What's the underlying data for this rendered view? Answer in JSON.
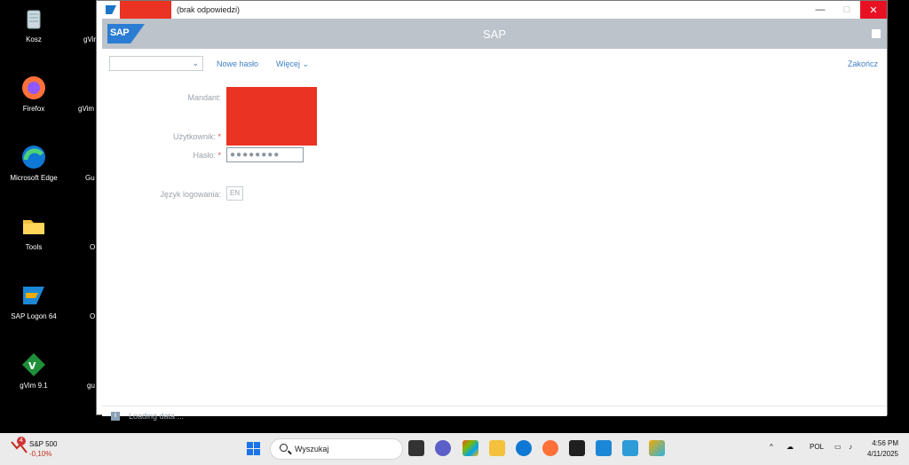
{
  "desktop": {
    "icons": [
      {
        "label": "Kosz",
        "icon": "recycle-bin-icon"
      },
      {
        "label": "Firefox",
        "icon": "firefox-icon"
      },
      {
        "label": "Microsoft Edge",
        "icon": "edge-icon"
      },
      {
        "label": "Tools",
        "icon": "folder-icon"
      },
      {
        "label": "SAP Logon 64",
        "icon": "sap-logon-icon"
      },
      {
        "label": "gVim 9.1",
        "icon": "gvim-icon"
      }
    ],
    "partial_labels": [
      "gVim",
      "gVim R",
      "Gu",
      "O",
      "O",
      "gu"
    ]
  },
  "window": {
    "title": "(brak odpowiedzi)",
    "min_glyph": "—",
    "max_glyph": "□",
    "close_glyph": "✕"
  },
  "shell": {
    "logo_text": "SAP",
    "title": "SAP"
  },
  "toolbar": {
    "dropdown_value": "",
    "new_password": "Nowe hasło",
    "more": "Więcej",
    "more_chevron": "⌄",
    "end": "Zakończ"
  },
  "form": {
    "client_label": "Mandant:",
    "user_label": "Użytkownik:",
    "password_label": "Hasło:",
    "required_mark": "*",
    "password_value": "●●●●●●●●",
    "language_label": "Język logowania:",
    "language_value": "EN"
  },
  "status": {
    "text": "Loading data ..."
  },
  "taskbar": {
    "stock_badge": "4",
    "stock_name": "S&P 500",
    "stock_change": "-0,10%",
    "search_placeholder": "Wyszukaj",
    "tray_chevron": "^",
    "lang": "POL",
    "time": "4:56 PM",
    "date": "4/11/2025"
  },
  "colors": {
    "sap_shell": "#bcc3ca",
    "link": "#3f80c8",
    "redaction": "#ea3323",
    "close_button": "#e81123"
  }
}
